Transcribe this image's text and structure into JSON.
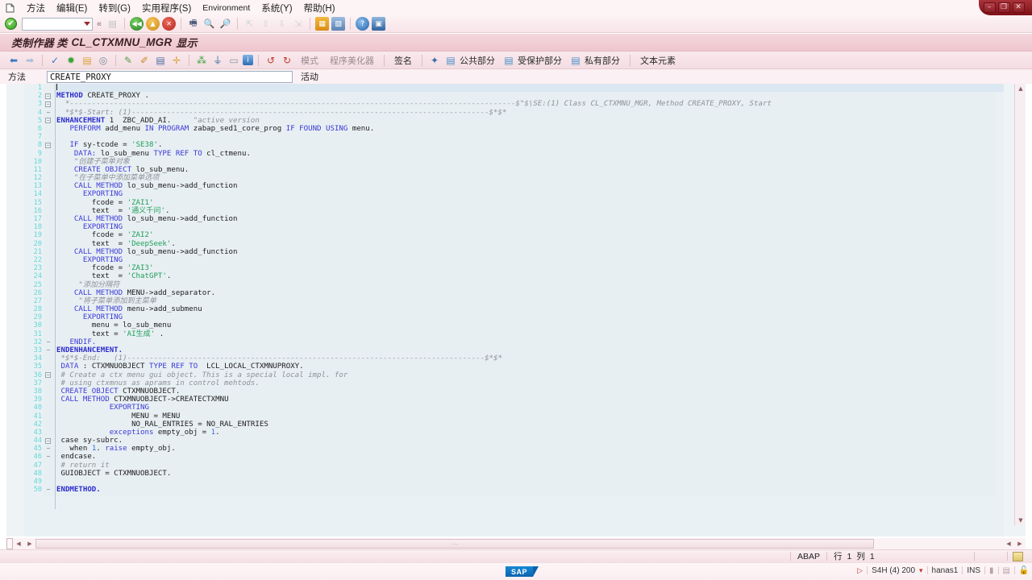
{
  "window": {
    "minimize_label": "–",
    "restore_label": "❐",
    "close_label": "✕"
  },
  "menubar": {
    "doc_icon": "document-icon",
    "items": [
      {
        "label": "方法",
        "mnemonic": ""
      },
      {
        "label": "编辑(E)",
        "mnemonic": "E"
      },
      {
        "label": "转到(G)",
        "mnemonic": "G"
      },
      {
        "label": "实用程序(S)",
        "mnemonic": "S"
      },
      {
        "label": "Environment",
        "mnemonic": ""
      },
      {
        "label": "系统(Y)",
        "mnemonic": "Y"
      },
      {
        "label": "帮助(H)",
        "mnemonic": "H"
      }
    ]
  },
  "toolbar": {
    "enter_icon": "check-enter-icon",
    "command_value": "",
    "command_placeholder": "",
    "dropdown_icon": "chevron-down-icon",
    "more_icon": "double-chevron-icon",
    "icons": [
      {
        "name": "save-icon",
        "glyph": "▤",
        "color": "#b7bfc6"
      },
      {
        "name": "back-icon",
        "glyph": "◀",
        "color": "#2e8b2e"
      },
      {
        "name": "exit-icon",
        "glyph": "▲",
        "color": "#e0a020"
      },
      {
        "name": "cancel-icon",
        "glyph": "✕",
        "color": "#cc3322"
      },
      {
        "name": "print-icon",
        "glyph": "🖶",
        "color": "#4a4a6a"
      },
      {
        "name": "find-icon",
        "glyph": "🔍",
        "color": "#3b6ea5"
      },
      {
        "name": "find-next-icon",
        "glyph": "🔎",
        "color": "#3b6ea5"
      },
      {
        "name": "first-page-icon",
        "glyph": "⇱",
        "color": "#c9ccd0"
      },
      {
        "name": "previous-page-icon",
        "glyph": "⇧",
        "color": "#c9ccd0"
      },
      {
        "name": "next-page-icon",
        "glyph": "⇩",
        "color": "#c9ccd0"
      },
      {
        "name": "last-page-icon",
        "glyph": "⇲",
        "color": "#c9ccd0"
      },
      {
        "name": "new-session-icon",
        "glyph": "▦",
        "color": "#e09a2a"
      },
      {
        "name": "create-shortcut-icon",
        "glyph": "▨",
        "color": "#5a7fb5"
      },
      {
        "name": "help-icon",
        "glyph": "?",
        "color": "#2e6fb7"
      },
      {
        "name": "customize-icon",
        "glyph": "▣",
        "color": "#4a7ab5"
      }
    ]
  },
  "page_title": {
    "prefix": "类制作器 类",
    "object": "CL_CTXMNU_MGR",
    "suffix": "显示"
  },
  "app_toolbar": {
    "icons": [
      {
        "name": "back-arrow-icon",
        "glyph": "⬅",
        "color": "#3b78c3"
      },
      {
        "name": "forward-arrow-icon",
        "glyph": "➡",
        "color": "#9fb8d6"
      },
      {
        "name": "check-syntax-icon",
        "glyph": "✓",
        "color": "#3b78c3"
      },
      {
        "name": "activate-icon",
        "glyph": "✹",
        "color": "#3aa33a"
      },
      {
        "name": "paste-icon",
        "glyph": "▤",
        "color": "#d8a33a"
      },
      {
        "name": "pattern-icon",
        "glyph": "◎",
        "color": "#7b8a96"
      },
      {
        "name": "display-change-icon",
        "glyph": "✎",
        "color": "#5a9b4a"
      },
      {
        "name": "pencil-icon",
        "glyph": "✐",
        "color": "#c98a2a"
      },
      {
        "name": "local-types-icon",
        "glyph": "▤",
        "color": "#4a6fa5"
      },
      {
        "name": "insert-icon",
        "glyph": "✛",
        "color": "#d8a33a"
      },
      {
        "name": "hierarchy-icon",
        "glyph": "⁂",
        "color": "#3aa33a"
      },
      {
        "name": "inheritance-icon",
        "glyph": "⏚",
        "color": "#3b6ea5"
      },
      {
        "name": "screen-icon",
        "glyph": "▭",
        "color": "#8a96a2"
      },
      {
        "name": "info-icon",
        "glyph": "i",
        "color": "#2e6fb7"
      },
      {
        "name": "undo-icon",
        "glyph": "↺",
        "color": "#c0392b"
      },
      {
        "name": "redo-icon",
        "glyph": "↻",
        "color": "#c0392b"
      }
    ],
    "pattern_label": "模式",
    "prettyprinter_label": "程序美化器",
    "signature_label": "签名",
    "public_section_label": "公共部分",
    "protected_section_label": "受保护部分",
    "private_section_label": "私有部分",
    "text_elements_label": "文本元素",
    "public_icon": "public-section-icon",
    "protected_icon": "protected-section-icon",
    "private_icon": "private-section-icon",
    "signature_icon": "signature-icon"
  },
  "method_row": {
    "label": "方法",
    "value": "CREATE_PROXY",
    "status": "活动"
  },
  "editor": {
    "lines": [
      {
        "n": 1,
        "fold": "",
        "segs": [
          {
            "t": "",
            "c": "plain"
          }
        ],
        "caret": true
      },
      {
        "n": 2,
        "fold": "minus",
        "segs": [
          {
            "t": "METHOD",
            "c": "kw"
          },
          {
            "t": " CREATE_PROXY .",
            "c": "plain"
          }
        ]
      },
      {
        "n": 3,
        "fold": "minus",
        "segs": [
          {
            "t": "  *-----------------------------------------------------------------------------------------------------$\"$\\SE:(1) Class CL_CTXMNU_MGR, Method CREATE_PROXY, Start",
            "c": "cmt"
          }
        ]
      },
      {
        "n": 4,
        "fold": "tick",
        "segs": [
          {
            "t": "  *$*$-Start: (1)---------------------------------------------------------------------------------$*$*",
            "c": "cmt"
          }
        ]
      },
      {
        "n": 5,
        "fold": "minus",
        "segs": [
          {
            "t": "ENHANCEMENT",
            "c": "kw"
          },
          {
            "t": " 1  ZBC_ADD_AI.     ",
            "c": "plain"
          },
          {
            "t": "\"active version",
            "c": "cmt"
          }
        ]
      },
      {
        "n": 6,
        "fold": "",
        "segs": [
          {
            "t": "   ",
            "c": "plain"
          },
          {
            "t": "PERFORM",
            "c": "kw2"
          },
          {
            "t": " add_menu ",
            "c": "plain"
          },
          {
            "t": "IN PROGRAM",
            "c": "kw2"
          },
          {
            "t": " zabap_sed1_core_prog ",
            "c": "plain"
          },
          {
            "t": "IF FOUND USING",
            "c": "kw2"
          },
          {
            "t": " menu.",
            "c": "plain"
          }
        ]
      },
      {
        "n": 7,
        "fold": "",
        "segs": [
          {
            "t": "",
            "c": "plain"
          }
        ]
      },
      {
        "n": 8,
        "fold": "minus",
        "segs": [
          {
            "t": "   ",
            "c": "plain"
          },
          {
            "t": "IF",
            "c": "kw2"
          },
          {
            "t": " sy-tcode = ",
            "c": "plain"
          },
          {
            "t": "'SE38'",
            "c": "str"
          },
          {
            "t": ".",
            "c": "plain"
          }
        ]
      },
      {
        "n": 9,
        "fold": "",
        "segs": [
          {
            "t": "    ",
            "c": "plain"
          },
          {
            "t": "DATA:",
            "c": "kw2"
          },
          {
            "t": " lo_sub_menu ",
            "c": "plain"
          },
          {
            "t": "TYPE REF TO",
            "c": "kw2"
          },
          {
            "t": " cl_ctmenu.",
            "c": "plain"
          }
        ]
      },
      {
        "n": 10,
        "fold": "",
        "segs": [
          {
            "t": "    \"创建子菜单对象",
            "c": "cmt"
          }
        ]
      },
      {
        "n": 11,
        "fold": "",
        "segs": [
          {
            "t": "    ",
            "c": "plain"
          },
          {
            "t": "CREATE OBJECT",
            "c": "kw2"
          },
          {
            "t": " lo_sub_menu.",
            "c": "plain"
          }
        ]
      },
      {
        "n": 12,
        "fold": "",
        "segs": [
          {
            "t": "    \"在子菜单中添加菜单选项",
            "c": "cmt"
          }
        ]
      },
      {
        "n": 13,
        "fold": "",
        "segs": [
          {
            "t": "    ",
            "c": "plain"
          },
          {
            "t": "CALL METHOD",
            "c": "kw2"
          },
          {
            "t": " lo_sub_menu->add_function",
            "c": "plain"
          }
        ]
      },
      {
        "n": 14,
        "fold": "",
        "segs": [
          {
            "t": "      ",
            "c": "plain"
          },
          {
            "t": "EXPORTING",
            "c": "kw2"
          }
        ]
      },
      {
        "n": 15,
        "fold": "",
        "segs": [
          {
            "t": "        fcode = ",
            "c": "plain"
          },
          {
            "t": "'ZAI1'",
            "c": "str"
          }
        ]
      },
      {
        "n": 16,
        "fold": "",
        "segs": [
          {
            "t": "        text  = ",
            "c": "plain"
          },
          {
            "t": "'通义千问'",
            "c": "str"
          },
          {
            "t": ".",
            "c": "plain"
          }
        ]
      },
      {
        "n": 17,
        "fold": "",
        "segs": [
          {
            "t": "    ",
            "c": "plain"
          },
          {
            "t": "CALL METHOD",
            "c": "kw2"
          },
          {
            "t": " lo_sub_menu->add_function",
            "c": "plain"
          }
        ]
      },
      {
        "n": 18,
        "fold": "",
        "segs": [
          {
            "t": "      ",
            "c": "plain"
          },
          {
            "t": "EXPORTING",
            "c": "kw2"
          }
        ]
      },
      {
        "n": 19,
        "fold": "",
        "segs": [
          {
            "t": "        fcode = ",
            "c": "plain"
          },
          {
            "t": "'ZAI2'",
            "c": "str"
          }
        ]
      },
      {
        "n": 20,
        "fold": "",
        "segs": [
          {
            "t": "        text  = ",
            "c": "plain"
          },
          {
            "t": "'DeepSeek'",
            "c": "str"
          },
          {
            "t": ".",
            "c": "plain"
          }
        ]
      },
      {
        "n": 21,
        "fold": "",
        "segs": [
          {
            "t": "    ",
            "c": "plain"
          },
          {
            "t": "CALL METHOD",
            "c": "kw2"
          },
          {
            "t": " lo_sub_menu->add_function",
            "c": "plain"
          }
        ]
      },
      {
        "n": 22,
        "fold": "",
        "segs": [
          {
            "t": "      ",
            "c": "plain"
          },
          {
            "t": "EXPORTING",
            "c": "kw2"
          }
        ]
      },
      {
        "n": 23,
        "fold": "",
        "segs": [
          {
            "t": "        fcode = ",
            "c": "plain"
          },
          {
            "t": "'ZAI3'",
            "c": "str"
          }
        ]
      },
      {
        "n": 24,
        "fold": "",
        "segs": [
          {
            "t": "        text  = ",
            "c": "plain"
          },
          {
            "t": "'ChatGPT'",
            "c": "str"
          },
          {
            "t": ".",
            "c": "plain"
          }
        ]
      },
      {
        "n": 25,
        "fold": "",
        "segs": [
          {
            "t": "     \"添加分隔符",
            "c": "cmt"
          }
        ]
      },
      {
        "n": 26,
        "fold": "",
        "segs": [
          {
            "t": "    ",
            "c": "plain"
          },
          {
            "t": "CALL METHOD",
            "c": "kw2"
          },
          {
            "t": " MENU->add_separator.",
            "c": "plain"
          }
        ]
      },
      {
        "n": 27,
        "fold": "",
        "segs": [
          {
            "t": "     \"将子菜单添加到主菜单",
            "c": "cmt"
          }
        ]
      },
      {
        "n": 28,
        "fold": "",
        "segs": [
          {
            "t": "    ",
            "c": "plain"
          },
          {
            "t": "CALL METHOD",
            "c": "kw2"
          },
          {
            "t": " menu->add_submenu",
            "c": "plain"
          }
        ]
      },
      {
        "n": 29,
        "fold": "",
        "segs": [
          {
            "t": "      ",
            "c": "plain"
          },
          {
            "t": "EXPORTING",
            "c": "kw2"
          }
        ]
      },
      {
        "n": 30,
        "fold": "",
        "segs": [
          {
            "t": "        menu = lo_sub_menu",
            "c": "plain"
          }
        ]
      },
      {
        "n": 31,
        "fold": "",
        "segs": [
          {
            "t": "        text = ",
            "c": "plain"
          },
          {
            "t": "'AI生成'",
            "c": "str"
          },
          {
            "t": " .",
            "c": "plain"
          }
        ]
      },
      {
        "n": 32,
        "fold": "tick",
        "segs": [
          {
            "t": "   ",
            "c": "plain"
          },
          {
            "t": "ENDIF.",
            "c": "kw2"
          }
        ]
      },
      {
        "n": 33,
        "fold": "tick",
        "segs": [
          {
            "t": "ENDENHANCEMENT.",
            "c": "kw"
          }
        ]
      },
      {
        "n": 34,
        "fold": "",
        "segs": [
          {
            "t": " *$*$-End:   (1)---------------------------------------------------------------------------------$*$*",
            "c": "cmt"
          }
        ]
      },
      {
        "n": 35,
        "fold": "",
        "segs": [
          {
            "t": " ",
            "c": "plain"
          },
          {
            "t": "DATA",
            "c": "kw2"
          },
          {
            "t": " : CTXMNUOBJECT ",
            "c": "plain"
          },
          {
            "t": "TYPE REF TO",
            "c": "kw2"
          },
          {
            "t": "  LCL_LOCAL_CTXMNUPROXY.",
            "c": "plain"
          }
        ]
      },
      {
        "n": 36,
        "fold": "minus",
        "segs": [
          {
            "t": " # Create a ctx menu gui object. This is a special local impl. for",
            "c": "cmt"
          }
        ]
      },
      {
        "n": 37,
        "fold": "",
        "segs": [
          {
            "t": " # using ctxmnus as aprams in control mehtods.",
            "c": "cmt"
          }
        ]
      },
      {
        "n": 38,
        "fold": "",
        "segs": [
          {
            "t": " ",
            "c": "plain"
          },
          {
            "t": "CREATE OBJECT",
            "c": "kw2"
          },
          {
            "t": " CTXMNUOBJECT.",
            "c": "plain"
          }
        ]
      },
      {
        "n": 39,
        "fold": "",
        "segs": [
          {
            "t": " ",
            "c": "plain"
          },
          {
            "t": "CALL METHOD",
            "c": "kw2"
          },
          {
            "t": " CTXMNUOBJECT->CREATECTXMNU",
            "c": "plain"
          }
        ]
      },
      {
        "n": 40,
        "fold": "",
        "segs": [
          {
            "t": "            ",
            "c": "plain"
          },
          {
            "t": "EXPORTING",
            "c": "kw2"
          }
        ]
      },
      {
        "n": 41,
        "fold": "",
        "segs": [
          {
            "t": "                 MENU = MENU",
            "c": "plain"
          }
        ]
      },
      {
        "n": 42,
        "fold": "",
        "segs": [
          {
            "t": "                 NO_RAL_ENTRIES = NO_RAL_ENTRIES",
            "c": "plain"
          }
        ]
      },
      {
        "n": 43,
        "fold": "",
        "segs": [
          {
            "t": "            ",
            "c": "plain"
          },
          {
            "t": "exceptions",
            "c": "kw2"
          },
          {
            "t": " empty_obj = ",
            "c": "plain"
          },
          {
            "t": "1",
            "c": "num"
          },
          {
            "t": ".",
            "c": "plain"
          }
        ]
      },
      {
        "n": 44,
        "fold": "minus",
        "segs": [
          {
            "t": " case sy-subrc.",
            "c": "plain"
          }
        ]
      },
      {
        "n": 45,
        "fold": "tick2",
        "segs": [
          {
            "t": "   when ",
            "c": "plain"
          },
          {
            "t": "1",
            "c": "num"
          },
          {
            "t": ". ",
            "c": "plain"
          },
          {
            "t": "raise",
            "c": "kw2"
          },
          {
            "t": " empty_obj.",
            "c": "plain"
          }
        ]
      },
      {
        "n": 46,
        "fold": "tick",
        "segs": [
          {
            "t": " endcase.",
            "c": "plain"
          }
        ]
      },
      {
        "n": 47,
        "fold": "",
        "segs": [
          {
            "t": " # return it",
            "c": "cmt"
          }
        ]
      },
      {
        "n": 48,
        "fold": "",
        "segs": [
          {
            "t": " GUIOBJECT = CTXMNUOBJECT.",
            "c": "plain"
          }
        ]
      },
      {
        "n": 49,
        "fold": "",
        "segs": [
          {
            "t": "",
            "c": "plain"
          }
        ]
      },
      {
        "n": 50,
        "fold": "tick",
        "segs": [
          {
            "t": "",
            "c": "plain"
          },
          {
            "t": "ENDMETHOD.",
            "c": "kw"
          }
        ]
      }
    ],
    "scroll_up_icon": "scroll-up-icon",
    "scroll_down_icon": "scroll-down-icon",
    "hscroll_left_icon": "scroll-left-icon",
    "hscroll_right_icon": "scroll-right-icon"
  },
  "status_bar": {
    "language": "ABAP",
    "position_label": "行",
    "line": "1",
    "column_label": "列",
    "column": "1",
    "insert_icon": "insert-mode-icon"
  },
  "footer": {
    "logo": "SAP",
    "arrow_icon": "status-arrow-icon",
    "system": "S4H (4) 200",
    "system_dropdown_icon": "chevron-down-icon",
    "server": "hanas1",
    "mode": "INS",
    "lock_icon": "lock-icon"
  },
  "colors": {
    "titlebar": "#f4d7dd",
    "toolbar": "#f7e4e8",
    "editor_bg": "#e8eff3",
    "keyword": "#2b2bcc",
    "comment": "#8c9298",
    "string": "#1fa05a",
    "number": "#3a6fd8",
    "linenumber": "#64d8d8",
    "accent": "#8d1c23"
  }
}
